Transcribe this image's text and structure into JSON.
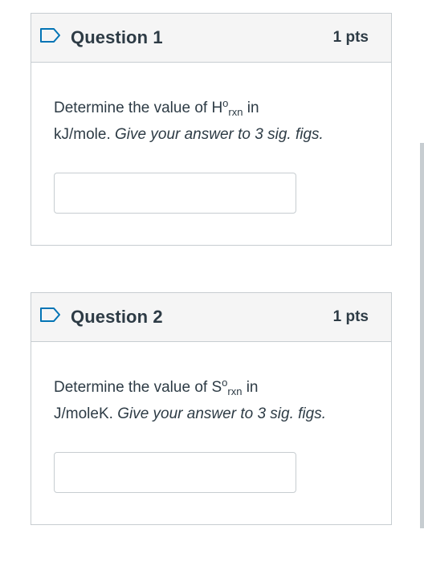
{
  "questions": [
    {
      "title": "Question 1",
      "points": "1 pts",
      "prompt_prefix": "Determine the value of H",
      "prompt_sup": "o",
      "prompt_sub": "rxn",
      "prompt_suffix": " in",
      "prompt_unit": "kJ/mole. ",
      "prompt_instruction": "Give your answer to 3 sig. figs.",
      "answer_value": ""
    },
    {
      "title": "Question 2",
      "points": "1 pts",
      "prompt_prefix": "Determine the value of S",
      "prompt_sup": "o",
      "prompt_sub": "rxn",
      "prompt_suffix": " in",
      "prompt_unit": "J/moleK. ",
      "prompt_instruction": "Give your answer to 3 sig. figs.",
      "answer_value": ""
    }
  ],
  "icons": {
    "flag": "bookmark-flag-icon"
  },
  "colors": {
    "text": "#2d3b45",
    "header_bg": "#f5f5f5",
    "border": "#c7cdd1",
    "flag_stroke": "#0374b5"
  }
}
